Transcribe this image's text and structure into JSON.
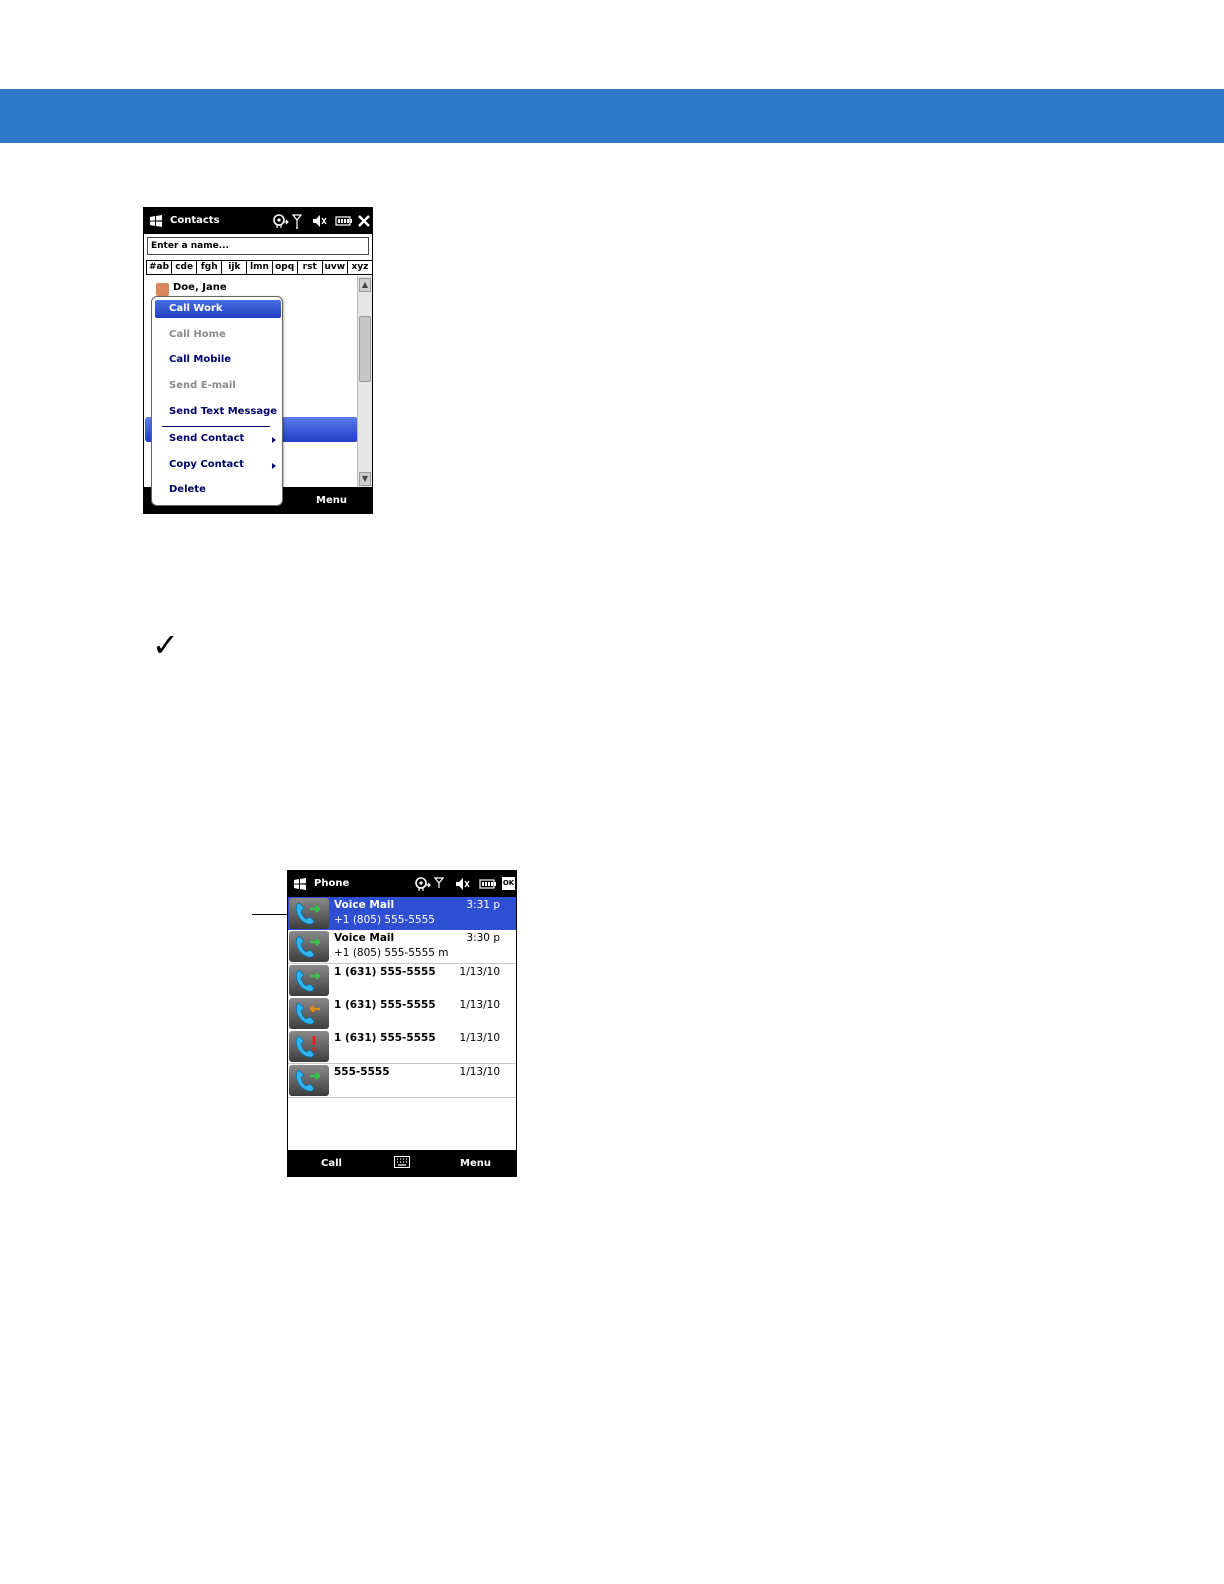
{
  "contacts_screen": {
    "title": "Contacts",
    "search_placeholder": "Enter a name...",
    "alpha_tabs": [
      "#ab",
      "cde",
      "fgh",
      "ijk",
      "lmn",
      "opq",
      "rst",
      "uvw",
      "xyz"
    ],
    "contact_name": "Doe, Jane",
    "context_menu": {
      "call_work": "Call Work",
      "call_home": "Call Home",
      "call_mobile": "Call Mobile",
      "send_email": "Send E-mail",
      "send_text": "Send Text Message",
      "send_contact": "Send Contact",
      "copy_contact": "Copy Contact",
      "delete": "Delete"
    },
    "softkey_right": "Menu"
  },
  "note": {
    "icon": "checkmark-icon"
  },
  "phone_screen": {
    "title": "Phone",
    "ok_label": "OK",
    "calls": [
      {
        "name": "Voice Mail",
        "number": "+1 (805) 555-5555",
        "time": "3:31 p",
        "type": "outgoing"
      },
      {
        "name": "Voice Mail",
        "number": "+1 (805) 555-5555 m",
        "time": "3:30 p",
        "type": "outgoing"
      },
      {
        "name": "1 (631) 555-5555",
        "number": "",
        "time": "1/13/10",
        "type": "outgoing"
      },
      {
        "name": "1 (631) 555-5555",
        "number": "",
        "time": "1/13/10",
        "type": "incoming"
      },
      {
        "name": "1 (631) 555-5555",
        "number": "",
        "time": "1/13/10",
        "type": "missed"
      },
      {
        "name": "555-5555",
        "number": "",
        "time": "1/13/10",
        "type": "outgoing"
      }
    ],
    "softkey_left": "Call",
    "softkey_right": "Menu"
  },
  "colors": {
    "header_band": "#2e79c7",
    "selection": "#2f4fd3",
    "menu_text": "#000066"
  }
}
